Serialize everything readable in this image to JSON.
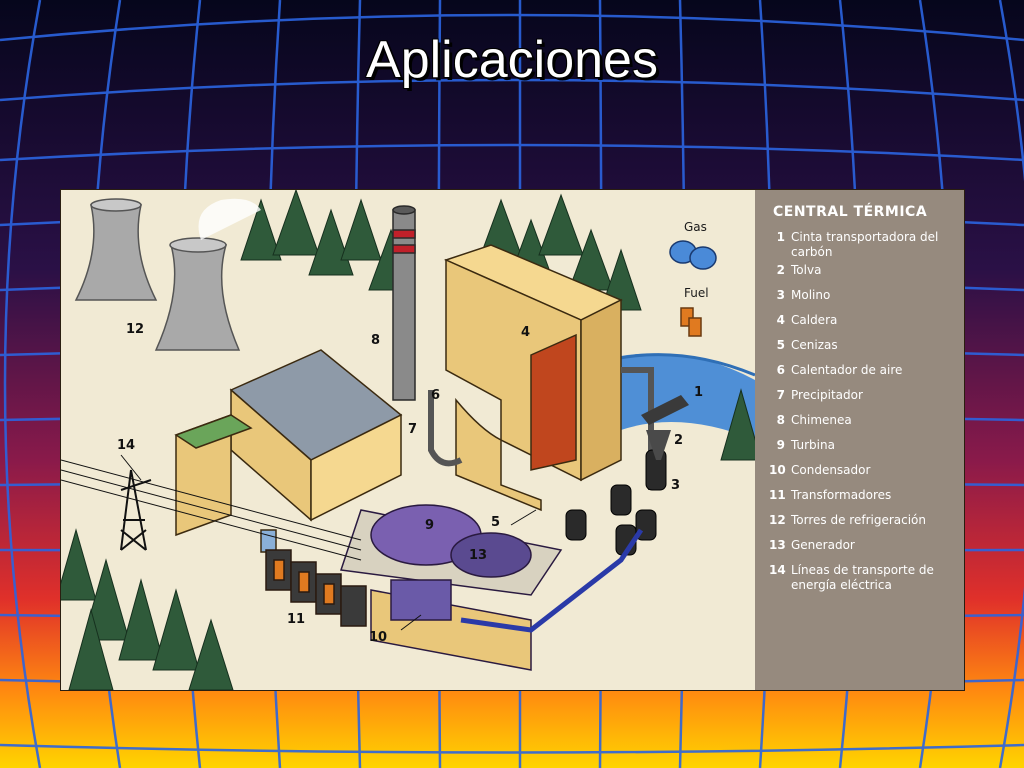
{
  "slide": {
    "title": "Aplicaciones",
    "colors": {
      "grid_line": "#2a5fd8",
      "sky_top": "#0a0a2e",
      "horizon": "#ffd000"
    }
  },
  "diagram": {
    "legend": {
      "title": "CENTRAL TÉRMICA",
      "items": [
        {
          "num": "1",
          "label": "Cinta transportadora del carbón"
        },
        {
          "num": "2",
          "label": "Tolva"
        },
        {
          "num": "3",
          "label": "Molino"
        },
        {
          "num": "4",
          "label": "Caldera"
        },
        {
          "num": "5",
          "label": "Cenizas"
        },
        {
          "num": "6",
          "label": "Calentador de aire"
        },
        {
          "num": "7",
          "label": "Precipitador"
        },
        {
          "num": "8",
          "label": "Chimenea"
        },
        {
          "num": "9",
          "label": "Turbina"
        },
        {
          "num": "10",
          "label": "Condensador"
        },
        {
          "num": "11",
          "label": "Transformadores"
        },
        {
          "num": "12",
          "label": "Torres de refrigeración"
        },
        {
          "num": "13",
          "label": "Generador"
        },
        {
          "num": "14",
          "label": "Líneas de transporte de energía eléctrica"
        }
      ]
    },
    "callouts": {
      "c1": "1",
      "c2": "2",
      "c3": "3",
      "c4": "4",
      "c5": "5",
      "c6": "6",
      "c7": "7",
      "c8": "8",
      "c9": "9",
      "c10": "10",
      "c11": "11",
      "c12": "12",
      "c13": "13",
      "c14": "14"
    },
    "fuel_labels": {
      "gas": "Gas",
      "fuel": "Fuel"
    }
  }
}
